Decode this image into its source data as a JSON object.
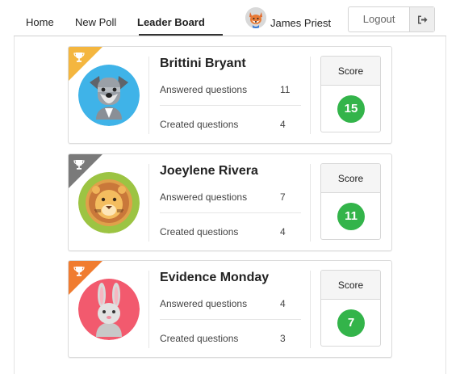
{
  "nav": {
    "items": [
      {
        "label": "Home"
      },
      {
        "label": "New Poll"
      },
      {
        "label": "Leader Board"
      }
    ],
    "active": "Leader Board",
    "user": {
      "name": "James Priest",
      "avatar_icon": "fox-avatar-icon"
    },
    "logout": {
      "label": "Logout",
      "icon": "sign-out-icon"
    }
  },
  "leaderboard": [
    {
      "rank_color": "#f4b63f",
      "avatar": "schnauzer-dog-avatar",
      "name": "Brittini Bryant",
      "answered_label": "Answered questions",
      "answered": "11",
      "created_label": "Created questions",
      "created": "4",
      "score_label": "Score",
      "score": "15"
    },
    {
      "rank_color": "#7a7a7a",
      "avatar": "lion-avatar",
      "name": "Joeylene Rivera",
      "answered_label": "Answered questions",
      "answered": "7",
      "created_label": "Created questions",
      "created": "4",
      "score_label": "Score",
      "score": "11"
    },
    {
      "rank_color": "#f07c30",
      "avatar": "rabbit-avatar",
      "name": "Evidence Monday",
      "answered_label": "Answered questions",
      "answered": "4",
      "created_label": "Created questions",
      "created": "3",
      "score_label": "Score",
      "score": "7"
    }
  ],
  "colors": {
    "score_badge": "#33b44a",
    "gold": "#f4b63f",
    "silver": "#7a7a7a",
    "bronze": "#f07c30"
  }
}
